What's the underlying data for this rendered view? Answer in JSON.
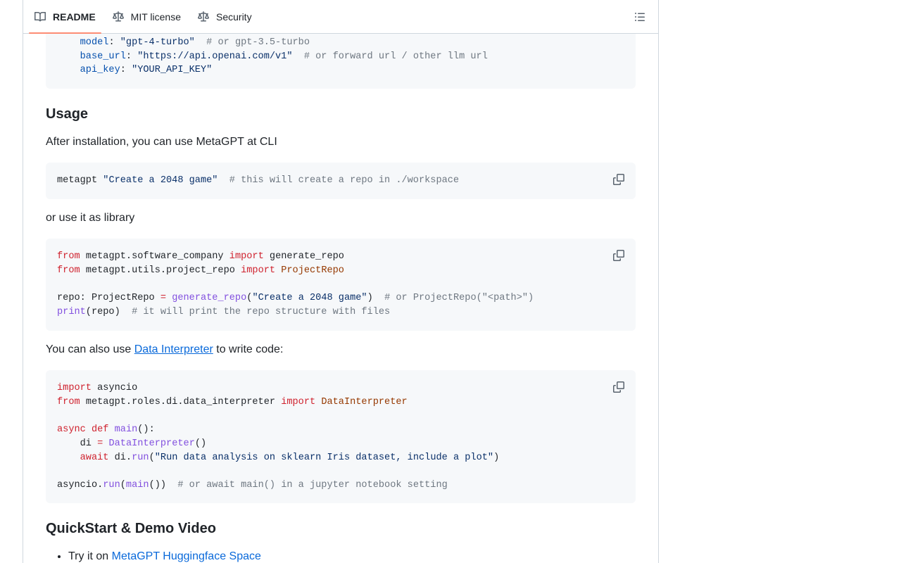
{
  "tabs": [
    {
      "label": "README",
      "icon": "book-icon",
      "active": true
    },
    {
      "label": "MIT license",
      "icon": "scale-icon",
      "active": false
    },
    {
      "label": "Security",
      "icon": "scale-icon",
      "active": false
    }
  ],
  "config_block": {
    "model_key": "model",
    "model_val": "\"gpt-4-turbo\"",
    "model_comment": "# or gpt-3.5-turbo",
    "base_url_key": "base_url",
    "base_url_val": "\"https://api.openai.com/v1\"",
    "base_url_comment": "# or forward url / other llm url",
    "api_key_key": "api_key",
    "api_key_val": "\"YOUR_API_KEY\""
  },
  "usage": {
    "heading": "Usage",
    "intro": "After installation, you can use MetaGPT at CLI",
    "cli_cmd": "metagpt",
    "cli_arg": "\"Create a 2048 game\"",
    "cli_comment": "# this will create a repo in ./workspace",
    "library_text": "or use it as library"
  },
  "lib_block": {
    "l1_from": "from",
    "l1_mod": "metagpt.software_company",
    "l1_import": "import",
    "l1_name": "generate_repo",
    "l2_from": "from",
    "l2_mod": "metagpt.utils.project_repo",
    "l2_import": "import",
    "l2_name": "ProjectRepo",
    "l3_var": "repo: ProjectRepo",
    "l3_eq": "=",
    "l3_fn": "generate_repo",
    "l3_arg": "\"Create a 2048 game\"",
    "l3_comment": "# or ProjectRepo(\"<path>\")",
    "l4_fn": "print",
    "l4_arg": "(repo)",
    "l4_comment": "# it will print the repo structure with files"
  },
  "interpreter": {
    "prefix": "You can also use ",
    "link": "Data Interpreter",
    "suffix": " to write code:"
  },
  "di_block": {
    "l1_import": "import",
    "l1_mod": "asyncio",
    "l2_from": "from",
    "l2_mod": "metagpt.roles.di.data_interpreter",
    "l2_import": "import",
    "l2_name": "DataInterpreter",
    "l3_async": "async",
    "l3_def": "def",
    "l3_fn": "main",
    "l3_rest": "():",
    "l4_var": "di",
    "l4_eq": "=",
    "l4_cls": "DataInterpreter",
    "l4_rest": "()",
    "l5_await": "await",
    "l5_obj": "di.",
    "l5_fn": "run",
    "l5_arg": "\"Run data analysis on sklearn Iris dataset, include a plot\"",
    "l6_obj": "asyncio.",
    "l6_fn": "run",
    "l6_inner": "main",
    "l6_comment": "# or await main() in a jupyter notebook setting"
  },
  "quickstart": {
    "heading": "QuickStart & Demo Video",
    "item1_prefix": "Try it on ",
    "item1_link": "MetaGPT Huggingface Space"
  }
}
